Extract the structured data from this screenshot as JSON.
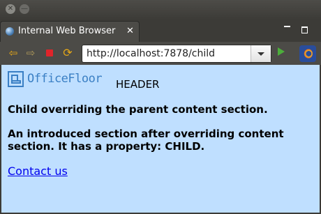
{
  "window": {
    "title": ""
  },
  "tab": {
    "title": "Internal Web Browser",
    "close_label": "✕",
    "icon": "globe-icon"
  },
  "toolbar": {
    "back_icon": "back-arrow-icon",
    "forward_icon": "forward-arrow-icon",
    "stop_icon": "stop-icon",
    "refresh_icon": "refresh-icon",
    "url": "http://localhost:7878/child",
    "go_icon": "go-icon",
    "eclipse_icon": "eclipse-icon"
  },
  "page": {
    "logo_text": "OfficeFloor",
    "header_label": "HEADER",
    "paragraph1": "Child overriding the parent content section.",
    "paragraph2": "An introduced section after overriding content section. It has a property: CHILD.",
    "link": "Contact us"
  },
  "colors": {
    "page_background": "#bfdfff",
    "link": "#0000ee",
    "logo": "#3a7fc4"
  }
}
